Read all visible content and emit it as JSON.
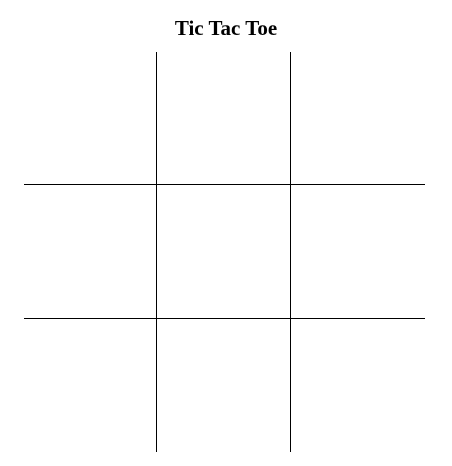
{
  "title": "Tic Tac Toe",
  "board": {
    "cells": [
      "",
      "",
      "",
      "",
      "",
      "",
      "",
      "",
      ""
    ]
  },
  "colors": {
    "background": "#ffffff",
    "lines": "#000000",
    "text": "#000000"
  }
}
